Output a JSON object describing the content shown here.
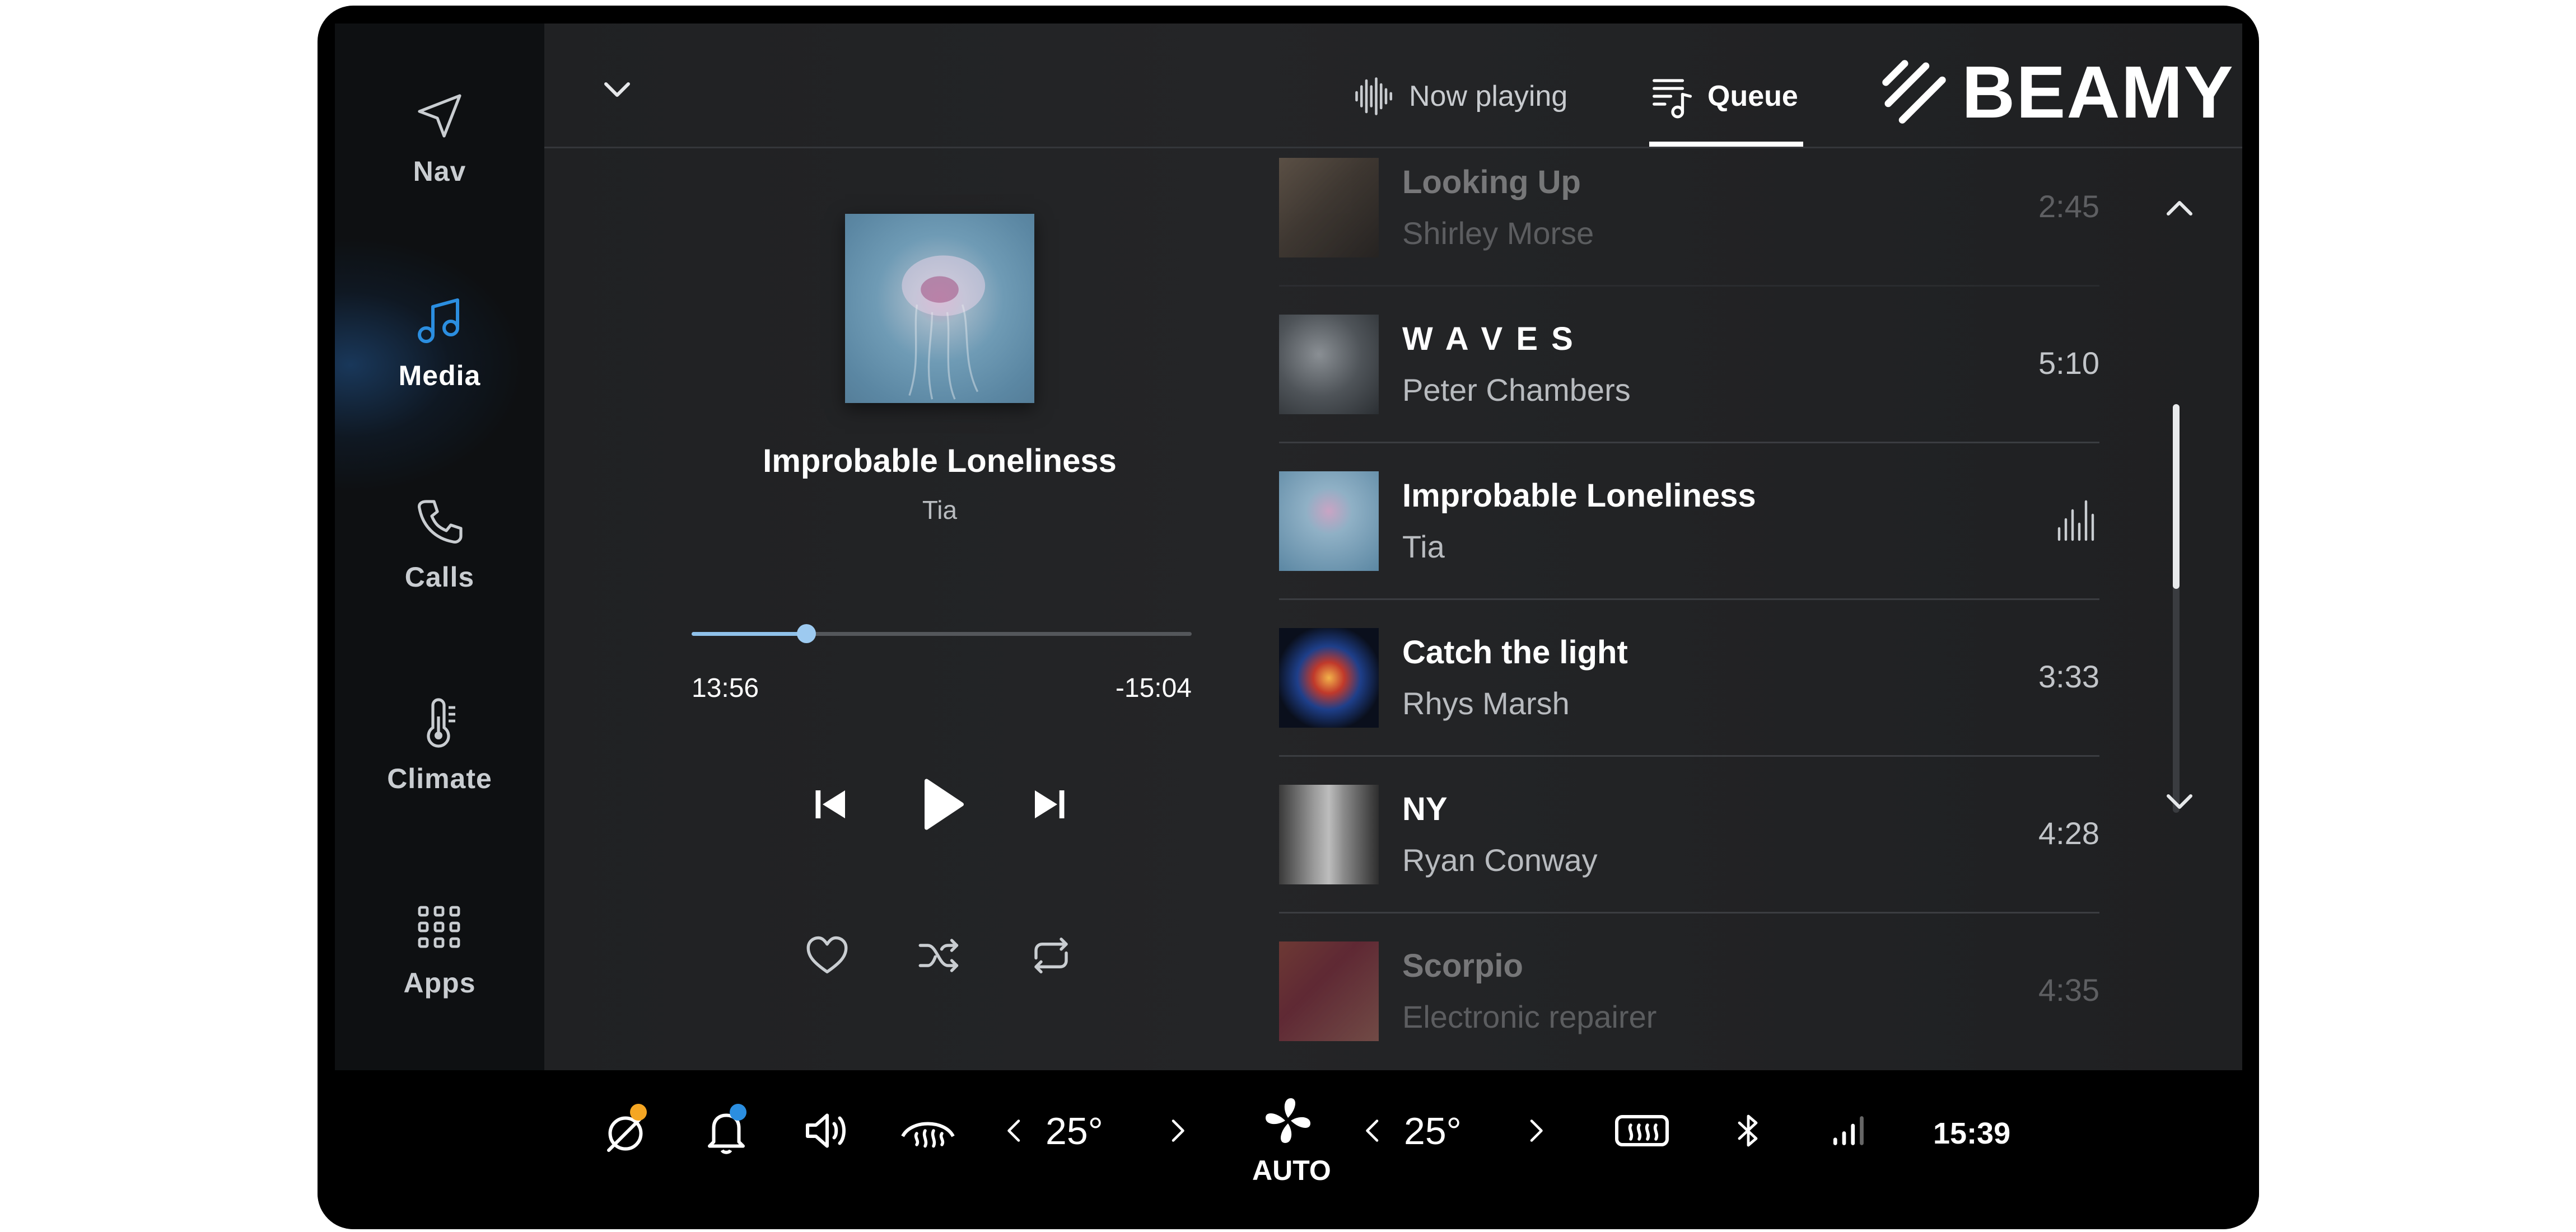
{
  "sidebar": {
    "items": [
      {
        "label": "Nav",
        "icon": "navigation-arrow-icon"
      },
      {
        "label": "Media",
        "icon": "music-note-icon",
        "active": true
      },
      {
        "label": "Calls",
        "icon": "phone-icon"
      },
      {
        "label": "Climate",
        "icon": "thermometer-icon"
      },
      {
        "label": "Apps",
        "icon": "apps-grid-icon"
      }
    ]
  },
  "header": {
    "tabs": [
      {
        "label": "Now playing",
        "icon": "waveform-icon"
      },
      {
        "label": "Queue",
        "icon": "queue-icon",
        "active": true
      }
    ],
    "logo": "BEAMY"
  },
  "now_playing": {
    "title": "Improbable Loneliness",
    "artist": "Tia",
    "elapsed": "13:56",
    "remaining": "-15:04",
    "progress": 0.23
  },
  "queue": [
    {
      "title": "Looking Up",
      "artist": "Shirley Morse",
      "duration": "2:45",
      "faded": true
    },
    {
      "title": "W A V E S",
      "artist": "Peter Chambers",
      "duration": "5:10"
    },
    {
      "title": "Improbable Loneliness",
      "artist": "Tia",
      "playing": true
    },
    {
      "title": "Catch the light",
      "artist": "Rhys Marsh",
      "duration": "3:33"
    },
    {
      "title": "NY",
      "artist": "Ryan Conway",
      "duration": "4:28"
    },
    {
      "title": "Scorpio",
      "artist": "Electronic repairer",
      "duration": "4:35",
      "faded": true
    }
  ],
  "bottom_bar": {
    "left_temp": "25°",
    "right_temp": "25°",
    "fan_mode": "AUTO",
    "time": "15:39"
  },
  "colors": {
    "accent": "#2b8ee0",
    "progress": "#8fc1ea",
    "notification_orange": "#f5a623",
    "notification_blue": "#2b8ee0"
  }
}
